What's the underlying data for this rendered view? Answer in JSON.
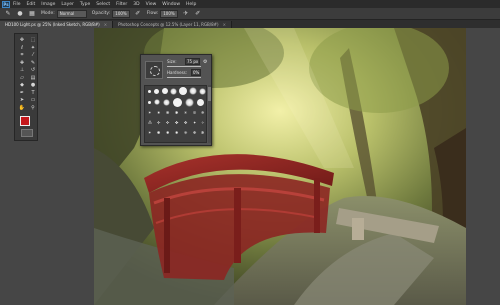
{
  "menubar": {
    "logo": "Ps",
    "items": [
      "File",
      "Edit",
      "Image",
      "Layer",
      "Type",
      "Select",
      "Filter",
      "3D",
      "View",
      "Window",
      "Help"
    ]
  },
  "options": {
    "mode_label": "Mode:",
    "mode_value": "Normal",
    "opacity_label": "Opacity:",
    "opacity_value": "100%",
    "flow_label": "Flow:",
    "flow_value": "100%"
  },
  "tabs": [
    {
      "label": "HD100 Light.ps @ 25% (Inked Sketch, RGB/8#)",
      "active": true
    },
    {
      "label": "Photoshop Concepts @ 12.5% (Layer 11, RGB/8#)",
      "active": false
    }
  ],
  "brush_panel": {
    "size_label": "Size:",
    "size_value": "75 px",
    "hardness_label": "Hardness:",
    "hardness_value": "0%"
  },
  "colors": {
    "foreground": "#c4171b",
    "background": "#111111",
    "ui_dark": "#2b2b2b",
    "panel": "#535353"
  }
}
